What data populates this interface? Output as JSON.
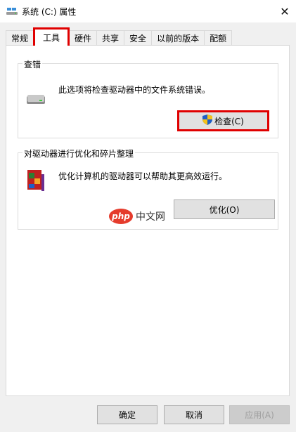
{
  "window": {
    "title": "系统 (C:) 属性",
    "close_glyph": "✕"
  },
  "tabs": [
    {
      "label": "常规"
    },
    {
      "label": "工具",
      "active": true
    },
    {
      "label": "硬件"
    },
    {
      "label": "共享"
    },
    {
      "label": "安全"
    },
    {
      "label": "以前的版本"
    },
    {
      "label": "配额"
    }
  ],
  "check_group": {
    "label": "查错",
    "description": "此选项将检查驱动器中的文件系统错误。",
    "button_label": "检查(C)"
  },
  "optimize_group": {
    "label": "对驱动器进行优化和碎片整理",
    "description": "优化计算机的驱动器可以帮助其更高效运行。",
    "button_label": "优化(O)"
  },
  "watermark": {
    "php": "php",
    "text": "中文网"
  },
  "footer": {
    "ok_label": "确定",
    "cancel_label": "取消",
    "apply_label": "应用(A)"
  },
  "colors": {
    "highlight": "#e00000",
    "accent_blue": "#0078d7"
  }
}
